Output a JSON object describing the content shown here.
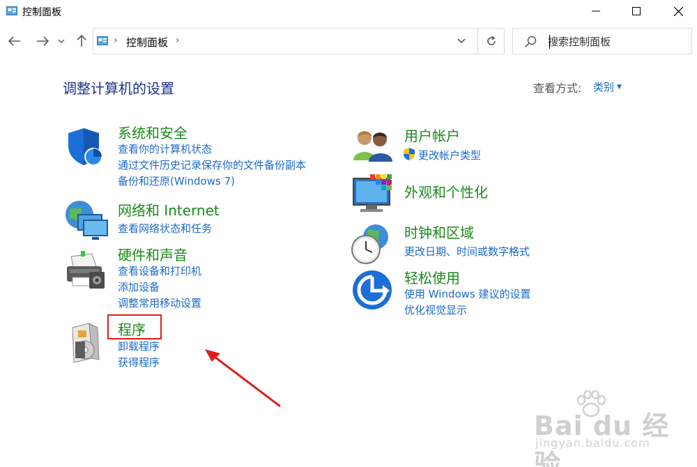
{
  "window": {
    "title": "控制面板",
    "min_label": "—",
    "max_label": "☐",
    "close_label": "✕"
  },
  "address": {
    "breadcrumb": "控制面板",
    "separator": "›"
  },
  "search": {
    "placeholder": "搜索控制面板",
    "value": ""
  },
  "header": {
    "title": "调整计算机的设置",
    "view_by_label": "查看方式:",
    "view_mode": "类别"
  },
  "categories": [
    {
      "title": "系统和安全",
      "icon": "shield-icon",
      "links": [
        "查看你的计算机状态",
        "通过文件历史记录保存你的文件备份副本",
        "备份和还原(Windows 7)"
      ]
    },
    {
      "title": "网络和 Internet",
      "icon": "network-globe-icon",
      "links": [
        "查看网络状态和任务"
      ]
    },
    {
      "title": "硬件和声音",
      "icon": "printer-icon",
      "links": [
        "查看设备和打印机",
        "添加设备",
        "调整常用移动设置"
      ]
    },
    {
      "title": "程序",
      "icon": "programs-disc-icon",
      "links": [
        "卸载程序",
        "获得程序"
      ]
    },
    {
      "title": "用户帐户",
      "icon": "users-icon",
      "links": [
        "更改帐户类型"
      ]
    },
    {
      "title": "外观和个性化",
      "icon": "monitor-palette-icon",
      "links": []
    },
    {
      "title": "时钟和区域",
      "icon": "clock-globe-icon",
      "links": [
        "更改日期、时间或数字格式"
      ]
    },
    {
      "title": "轻松使用",
      "icon": "ease-of-access-icon",
      "links": [
        "使用 Windows 建议的设置",
        "优化视觉显示"
      ]
    }
  ],
  "annotation": {
    "highlight_color": "#e01d1d"
  },
  "watermark": {
    "main": "Bai du 经验",
    "sub": "jingyan.baidu.com"
  },
  "colors": {
    "category_title": "#1a8a1a",
    "link": "#1b6ac9",
    "page_title": "#1e3287"
  }
}
